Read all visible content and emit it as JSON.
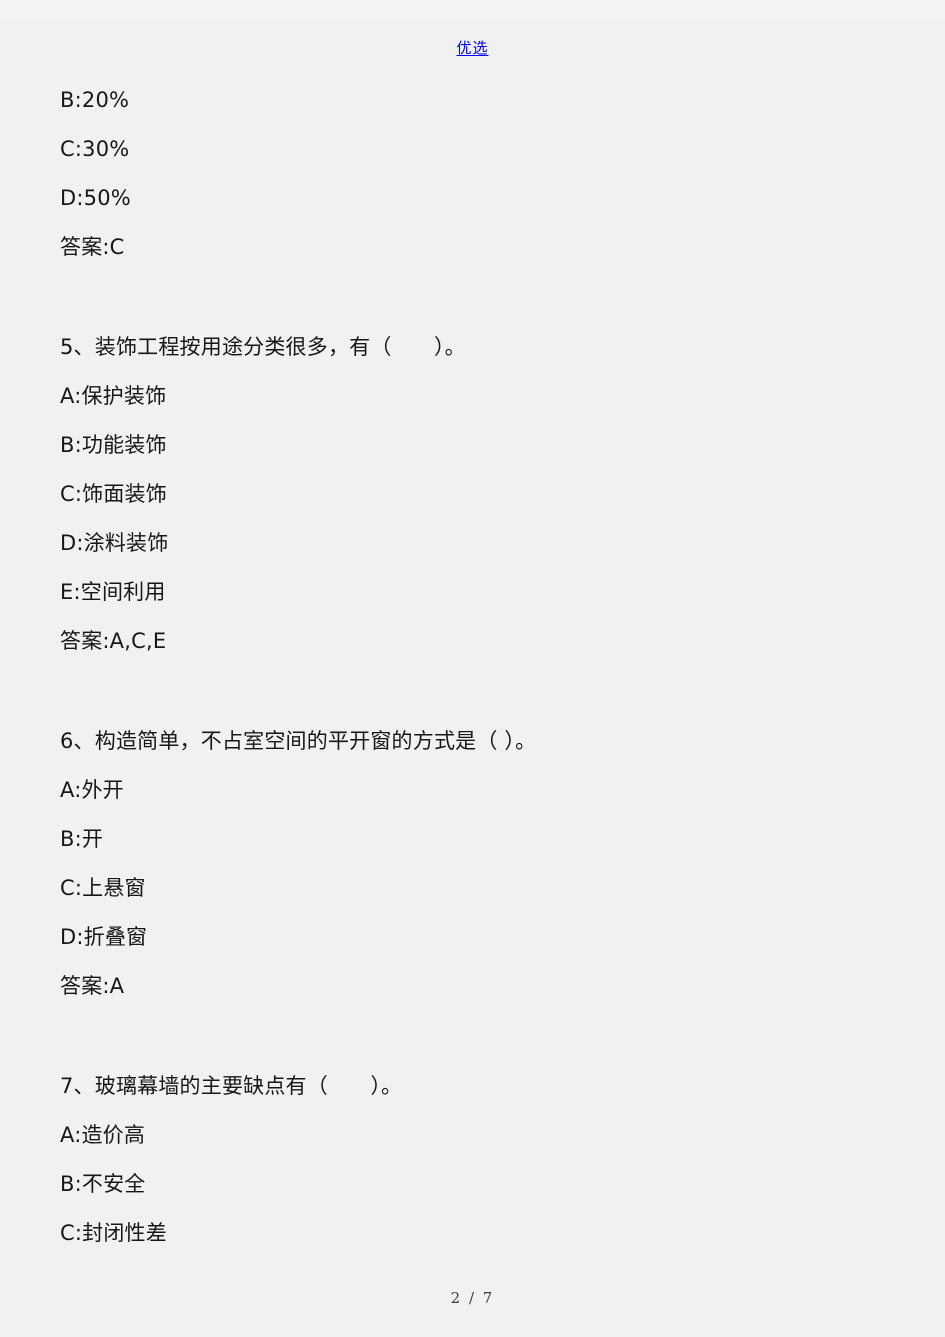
{
  "document": {
    "header_watermark": "优选",
    "footer_page_label": "2 / 7",
    "page_background": "#f1f1f1",
    "canvas_background": "#f4f4f4",
    "watermark_color": "#0000ff",
    "text_color": "#171717"
  },
  "continued_question": {
    "lines": [
      "B:20%",
      "C:30%",
      "D:50%",
      "答案:C"
    ]
  },
  "questions": [
    {
      "number": "5",
      "stem": "5、装饰工程按用途分类很多，有（　　）。",
      "options": [
        "A:保护装饰",
        "B:功能装饰",
        "C:饰面装饰",
        "D:涂料装饰",
        "E:空间利用"
      ],
      "answer": "答案:A,C,E"
    },
    {
      "number": "6",
      "stem": "6、构造简单，不占室空间的平开窗的方式是（ ）。",
      "options": [
        "A:外开",
        "B:开",
        "C:上悬窗",
        "D:折叠窗"
      ],
      "answer": "答案:A"
    },
    {
      "number": "7",
      "stem": "7、玻璃幕墙的主要缺点有（　　）。",
      "options": [
        "A:造价高",
        "B:不安全",
        "C:封闭性差"
      ],
      "answer": ""
    }
  ]
}
